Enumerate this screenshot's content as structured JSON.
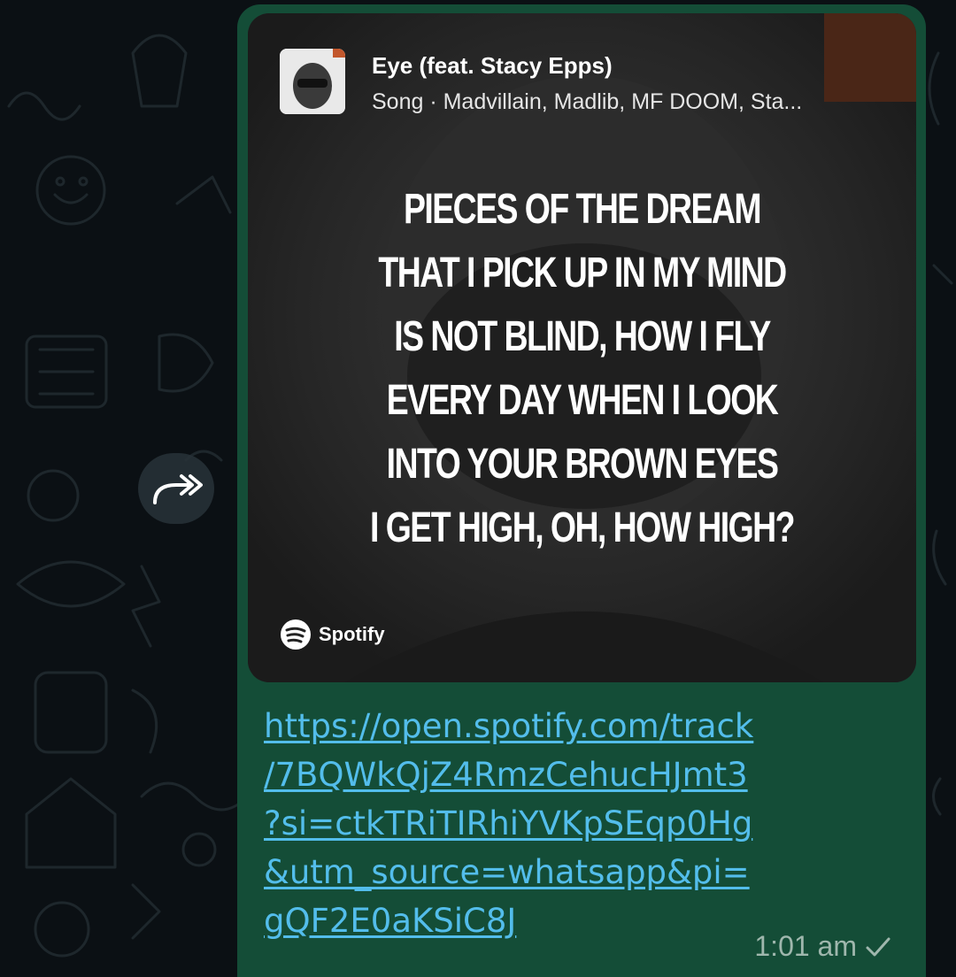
{
  "colors": {
    "chat_background": "#0b1014",
    "bubble": "#144d37",
    "link": "#53bdeb",
    "timestamp": "#9fb7ad"
  },
  "forward": {
    "icon": "forward-double-arrow-icon"
  },
  "preview": {
    "track_title": "Eye (feat. Stacy Epps)",
    "track_subtitle": "Song · Madvillain, Madlib, MF DOOM, Sta...",
    "lyrics": [
      "PIECES OF THE DREAM",
      "THAT I PICK UP IN MY MIND",
      "IS NOT BLIND, HOW I FLY",
      "EVERY DAY WHEN I LOOK",
      "INTO YOUR BROWN EYES",
      "I GET HIGH, OH, HOW HIGH?"
    ],
    "brand": "Spotify",
    "brand_icon": "spotify-logo-icon"
  },
  "message": {
    "link_lines": [
      "https://open.spotify.com/track",
      "/7BQWkQjZ4RmzCehucHJmt3",
      "?si=ctkTRiTIRhiYVKpSEqp0Hg",
      "&utm_source=whatsapp&pi=",
      "gQF2E0aKSiC8J"
    ],
    "time": "1:01 am",
    "status_icon": "sent-check-icon"
  }
}
